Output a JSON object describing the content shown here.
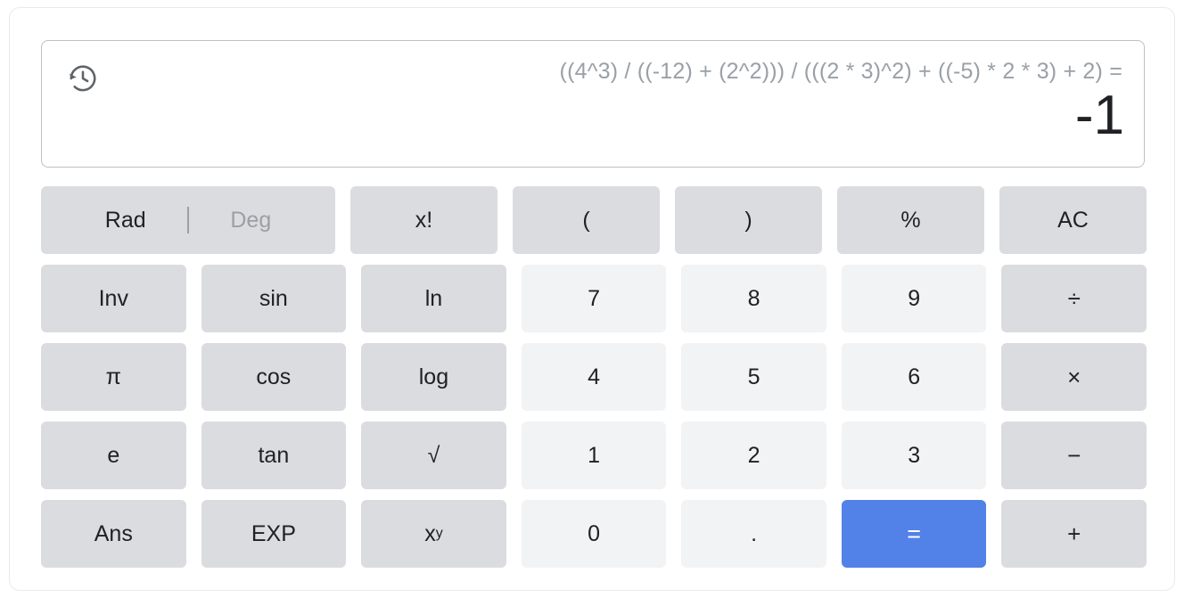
{
  "display": {
    "history_icon": "history-icon",
    "expression": "((4^3) / ((-12) + (2^2))) / (((2 * 3)^2) + ((-5) * 2 * 3) + 2) =",
    "result": "-1"
  },
  "colors": {
    "function_button": "#dadce0",
    "digit_button": "#f1f3f4",
    "equals_button": "#5281e8",
    "text_primary": "#202124",
    "text_muted": "#9aa0a6",
    "display_border": "#bdc1c6",
    "card_border": "#e8eaed"
  },
  "keypad": {
    "angle_mode": {
      "rad_label": "Rad",
      "deg_label": "Deg",
      "selected": "Rad"
    },
    "rows": [
      [
        {
          "label": "x!",
          "kind": "fn"
        },
        {
          "label": "(",
          "kind": "fn"
        },
        {
          "label": ")",
          "kind": "fn"
        },
        {
          "label": "%",
          "kind": "fn"
        },
        {
          "label": "AC",
          "kind": "fn"
        }
      ],
      [
        {
          "label": "Inv",
          "kind": "fn"
        },
        {
          "label": "sin",
          "kind": "fn"
        },
        {
          "label": "ln",
          "kind": "fn"
        },
        {
          "label": "7",
          "kind": "digit"
        },
        {
          "label": "8",
          "kind": "digit"
        },
        {
          "label": "9",
          "kind": "digit"
        },
        {
          "label": "÷",
          "kind": "op"
        }
      ],
      [
        {
          "label": "π",
          "kind": "fn"
        },
        {
          "label": "cos",
          "kind": "fn"
        },
        {
          "label": "log",
          "kind": "fn"
        },
        {
          "label": "4",
          "kind": "digit"
        },
        {
          "label": "5",
          "kind": "digit"
        },
        {
          "label": "6",
          "kind": "digit"
        },
        {
          "label": "×",
          "kind": "op"
        }
      ],
      [
        {
          "label": "e",
          "kind": "fn"
        },
        {
          "label": "tan",
          "kind": "fn"
        },
        {
          "label": "√",
          "kind": "fn"
        },
        {
          "label": "1",
          "kind": "digit"
        },
        {
          "label": "2",
          "kind": "digit"
        },
        {
          "label": "3",
          "kind": "digit"
        },
        {
          "label": "−",
          "kind": "op"
        }
      ],
      [
        {
          "label": "Ans",
          "kind": "fn"
        },
        {
          "label": "EXP",
          "kind": "fn"
        },
        {
          "label": "x",
          "sup": "y",
          "kind": "fn"
        },
        {
          "label": "0",
          "kind": "digit"
        },
        {
          "label": ".",
          "kind": "digit"
        },
        {
          "label": "=",
          "kind": "equals"
        },
        {
          "label": "+",
          "kind": "op"
        }
      ]
    ]
  }
}
